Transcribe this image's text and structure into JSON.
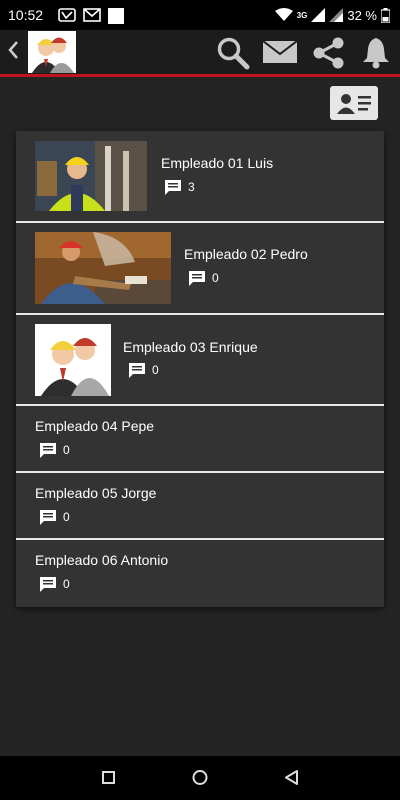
{
  "status": {
    "time": "10:52",
    "network": "3G",
    "battery": "32 %"
  },
  "toolbar": {
    "icons": [
      "search-icon",
      "mail-icon",
      "share-icon",
      "bell-icon"
    ],
    "vcard_icon": "contact-card-icon"
  },
  "employees": [
    {
      "name": "Empleado 01 Luis",
      "comments": "3",
      "photo": "worker-hardhat"
    },
    {
      "name": "Empleado 02 Pedro",
      "comments": "0",
      "photo": "worker-welding"
    },
    {
      "name": "Empleado 03 Enrique",
      "comments": "0",
      "photo": "workers-illustration"
    },
    {
      "name": "Empleado 04 Pepe",
      "comments": "0"
    },
    {
      "name": "Empleado 05 Jorge",
      "comments": "0"
    },
    {
      "name": "Empleado 06 Antonio",
      "comments": "0"
    }
  ],
  "colors": {
    "accent": "#c1121f",
    "background": "#242424",
    "card": "#333333"
  }
}
